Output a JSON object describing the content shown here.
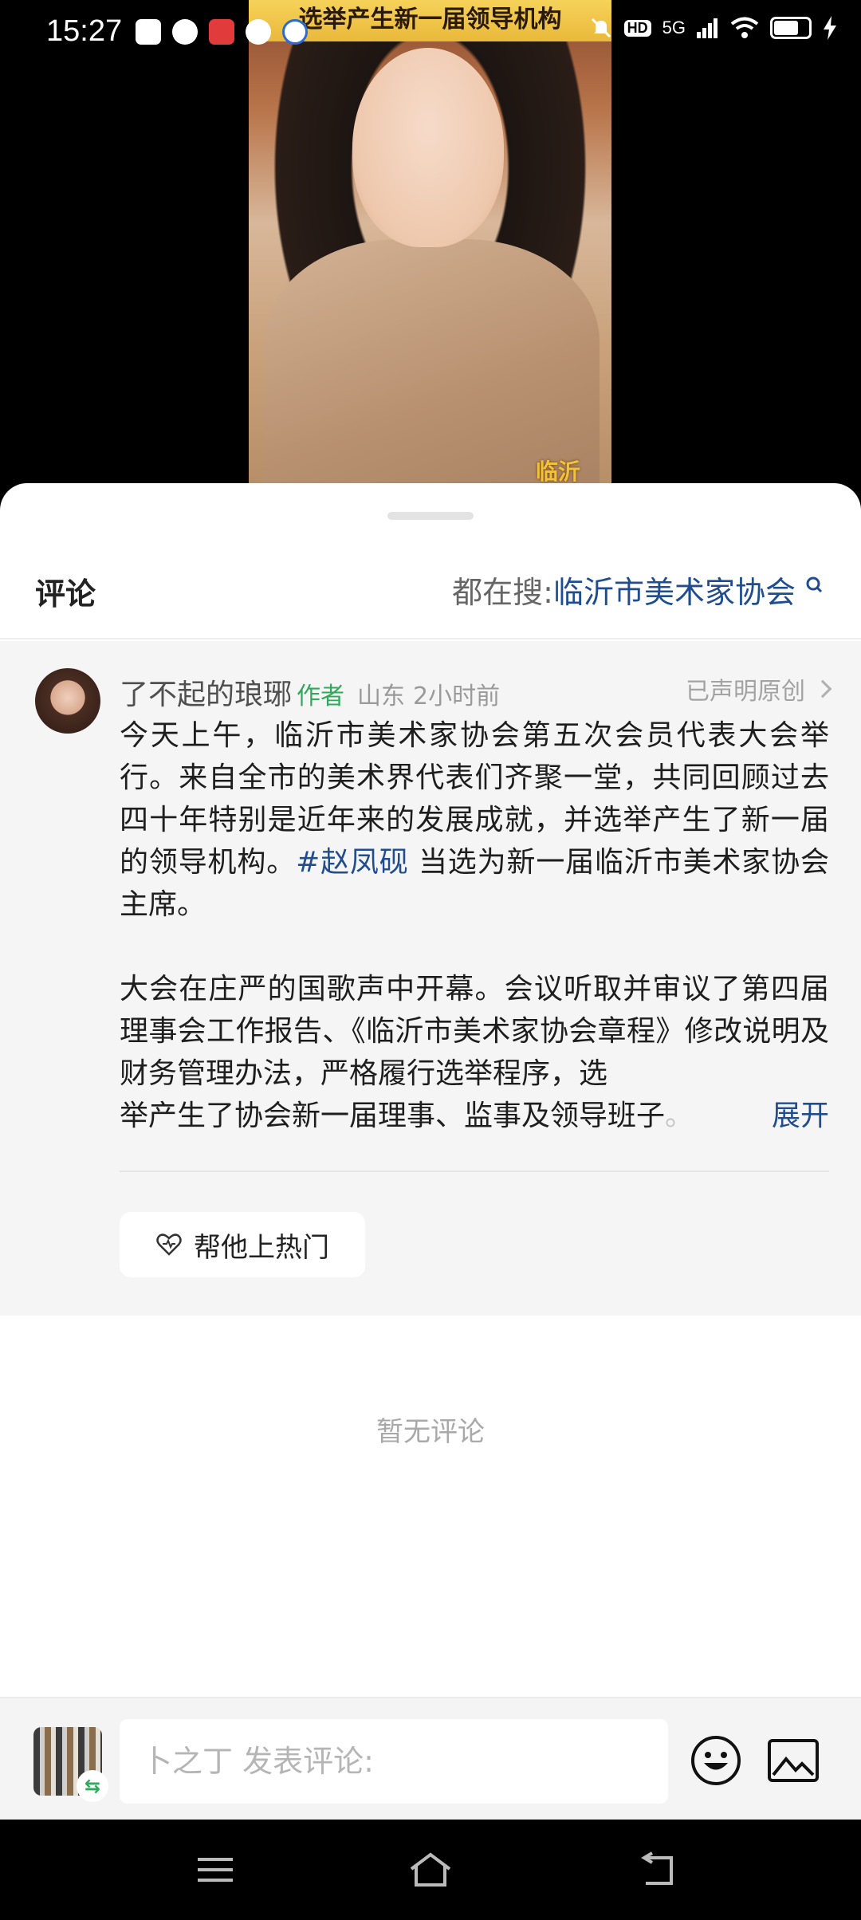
{
  "status_bar": {
    "time": "15:27",
    "network": "5G",
    "hd": "HD",
    "battery_level": 0.72
  },
  "video": {
    "caption": "选举产生新一届领导机构",
    "corner_text": "临沂"
  },
  "sheet": {
    "title": "评论",
    "trending_prefix": "都在搜: ",
    "trending_term": "临沂市美术家协会"
  },
  "post": {
    "author": "了不起的琅琊",
    "author_tag": "作者",
    "location": "山东",
    "time": "2小时前",
    "declared": "已声明原创",
    "para1_a": "今天上午，临沂市美术家协会第五次会员代表大会举行。来自全市的美术界代表们齐聚一堂，共同回顾过去四十年特别是近年来的发展成就，并选举产生了新一届的领导机构。",
    "hashtag": "#赵凤砚",
    "para1_b": " 当选为新一届临沂市美术家协会主席。",
    "para2": "大会在庄严的国歌声中开幕。会议听取并审议了第四届理事会工作报告、《临沂市美术家协会章程》修改说明及财务管理办法，严格履行选举程序，选",
    "para2_last": "举产生了协会新一届理事、监事及领导班子",
    "para2_fade": "。",
    "expand": "展开",
    "boost_label": "帮他上热门"
  },
  "comments": {
    "empty": "暂无评论"
  },
  "composer": {
    "placeholder": "卜之丁 发表评论:",
    "swap_glyph": "⇆"
  },
  "icons": {
    "search": "search-icon",
    "heart": "heart-icon",
    "emoji": "emoji-icon",
    "image": "image-icon"
  },
  "colors": {
    "link": "#1f4d8f",
    "author_tag": "#2faa5a"
  }
}
